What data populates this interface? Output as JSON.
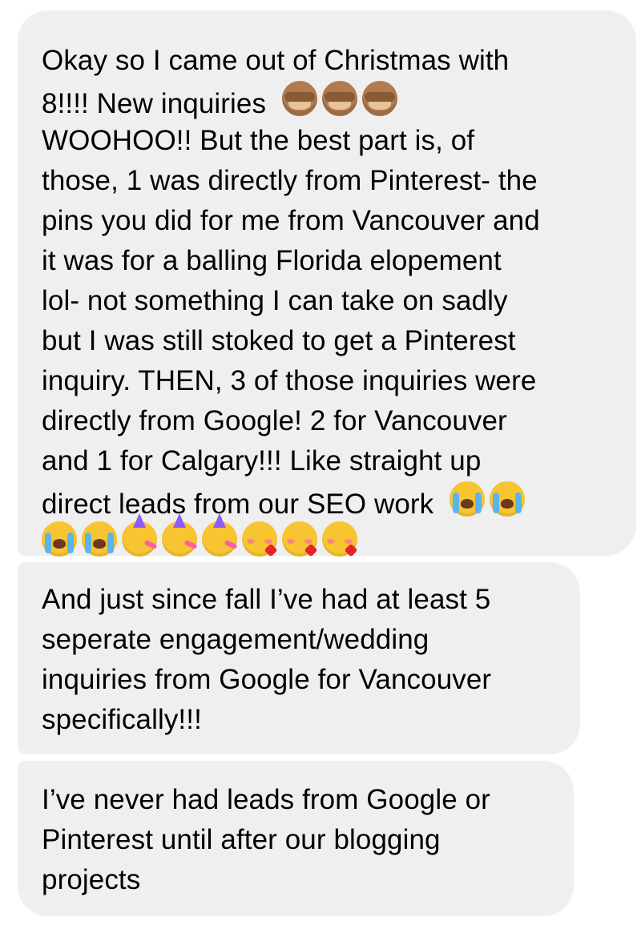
{
  "messages": [
    {
      "lines": [
        "Okay so I came out of Christmas with",
        "8!!!! New inquiries",
        "WOOHOO!! But the best part is, of",
        "those, 1 was directly from Pinterest- the",
        "pins you did for me from Vancouver and",
        "it was for a balling Florida elopement",
        "lol- not something I can take on sadly",
        "but I was still stoked to get a Pinterest",
        "inquiry. THEN, 3 of those inquiries were",
        "directly from Google! 2 for Vancouver",
        "and 1 for Calgary!!! Like straight up",
        "direct leads from our SEO work"
      ],
      "emoji": {
        "after_line_2": [
          "see-no-evil-monkey-icon",
          "see-no-evil-monkey-icon",
          "see-no-evil-monkey-icon"
        ],
        "after_line_12": [
          "loudly-crying-face-icon",
          "loudly-crying-face-icon"
        ],
        "last_row": [
          "loudly-crying-face-icon",
          "loudly-crying-face-icon",
          "partying-face-icon",
          "partying-face-icon",
          "partying-face-icon",
          "smiling-face-with-hearts-icon",
          "smiling-face-with-hearts-icon",
          "smiling-face-with-hearts-icon"
        ]
      }
    },
    {
      "lines": [
        "And just since fall I’ve had at least 5",
        "seperate engagement/wedding",
        "inquiries from Google for Vancouver",
        "specifically!!!"
      ]
    },
    {
      "lines": [
        "I’ve never had leads from Google or",
        "Pinterest until after our blogging",
        "projects"
      ]
    }
  ],
  "colors": {
    "bubble_background": "#efeff0",
    "text": "#000000",
    "page_background": "#ffffff"
  }
}
